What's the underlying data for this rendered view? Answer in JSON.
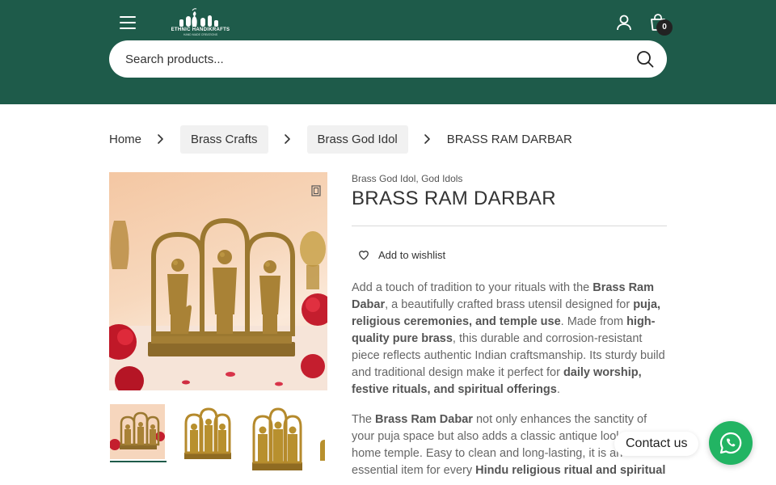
{
  "header": {
    "logo": {
      "brand": "ETHNIC HANDIKRAFTS",
      "tagline": "HAND MADE CREATIONS"
    },
    "cart_count": "0",
    "icons": {
      "menu": "hamburger-icon",
      "account": "user-icon",
      "cart": "shopping-bag-icon",
      "search": "search-icon"
    },
    "background_color": "#1e5b4a"
  },
  "search": {
    "placeholder": "Search products...",
    "value": ""
  },
  "breadcrumb": {
    "home": "Home",
    "level1": "Brass Crafts",
    "level2": "Brass God Idol",
    "current": "BRASS RAM DARBAR"
  },
  "product": {
    "categories": [
      "Brass God Idol",
      "God Idols"
    ],
    "category_separator": ",",
    "title": "BRASS RAM DARBAR",
    "wishlist_label": "Add to wishlist",
    "description": {
      "p1": {
        "t1": "Add a touch of tradition to your rituals with the ",
        "b1": "Brass Ram Dabar",
        "t2": ", a beautifully crafted brass utensil designed for ",
        "b2": "puja, religious ceremonies, and temple use",
        "t3": ". Made from ",
        "b3": "high-quality pure brass",
        "t4": ", this durable and corrosion-resistant piece reflects authentic Indian craftsmanship. Its sturdy build and traditional design make it perfect for ",
        "b4": "daily worship, festive rituals, and spiritual offerings",
        "t5": "."
      },
      "p2": {
        "t1": "The ",
        "b1": "Brass Ram Dabar",
        "t2": " not only enhances the sanctity of your puja space but also adds a classic antique look to your home temple. Easy to clean and long-lasting, it is an essential item for every ",
        "b2": "Hindu religious ritual and spiritual"
      }
    },
    "thumbnail_count": 4
  },
  "contact": {
    "label": "Contact us",
    "icon": "whatsapp-icon",
    "color": "#22b463"
  }
}
